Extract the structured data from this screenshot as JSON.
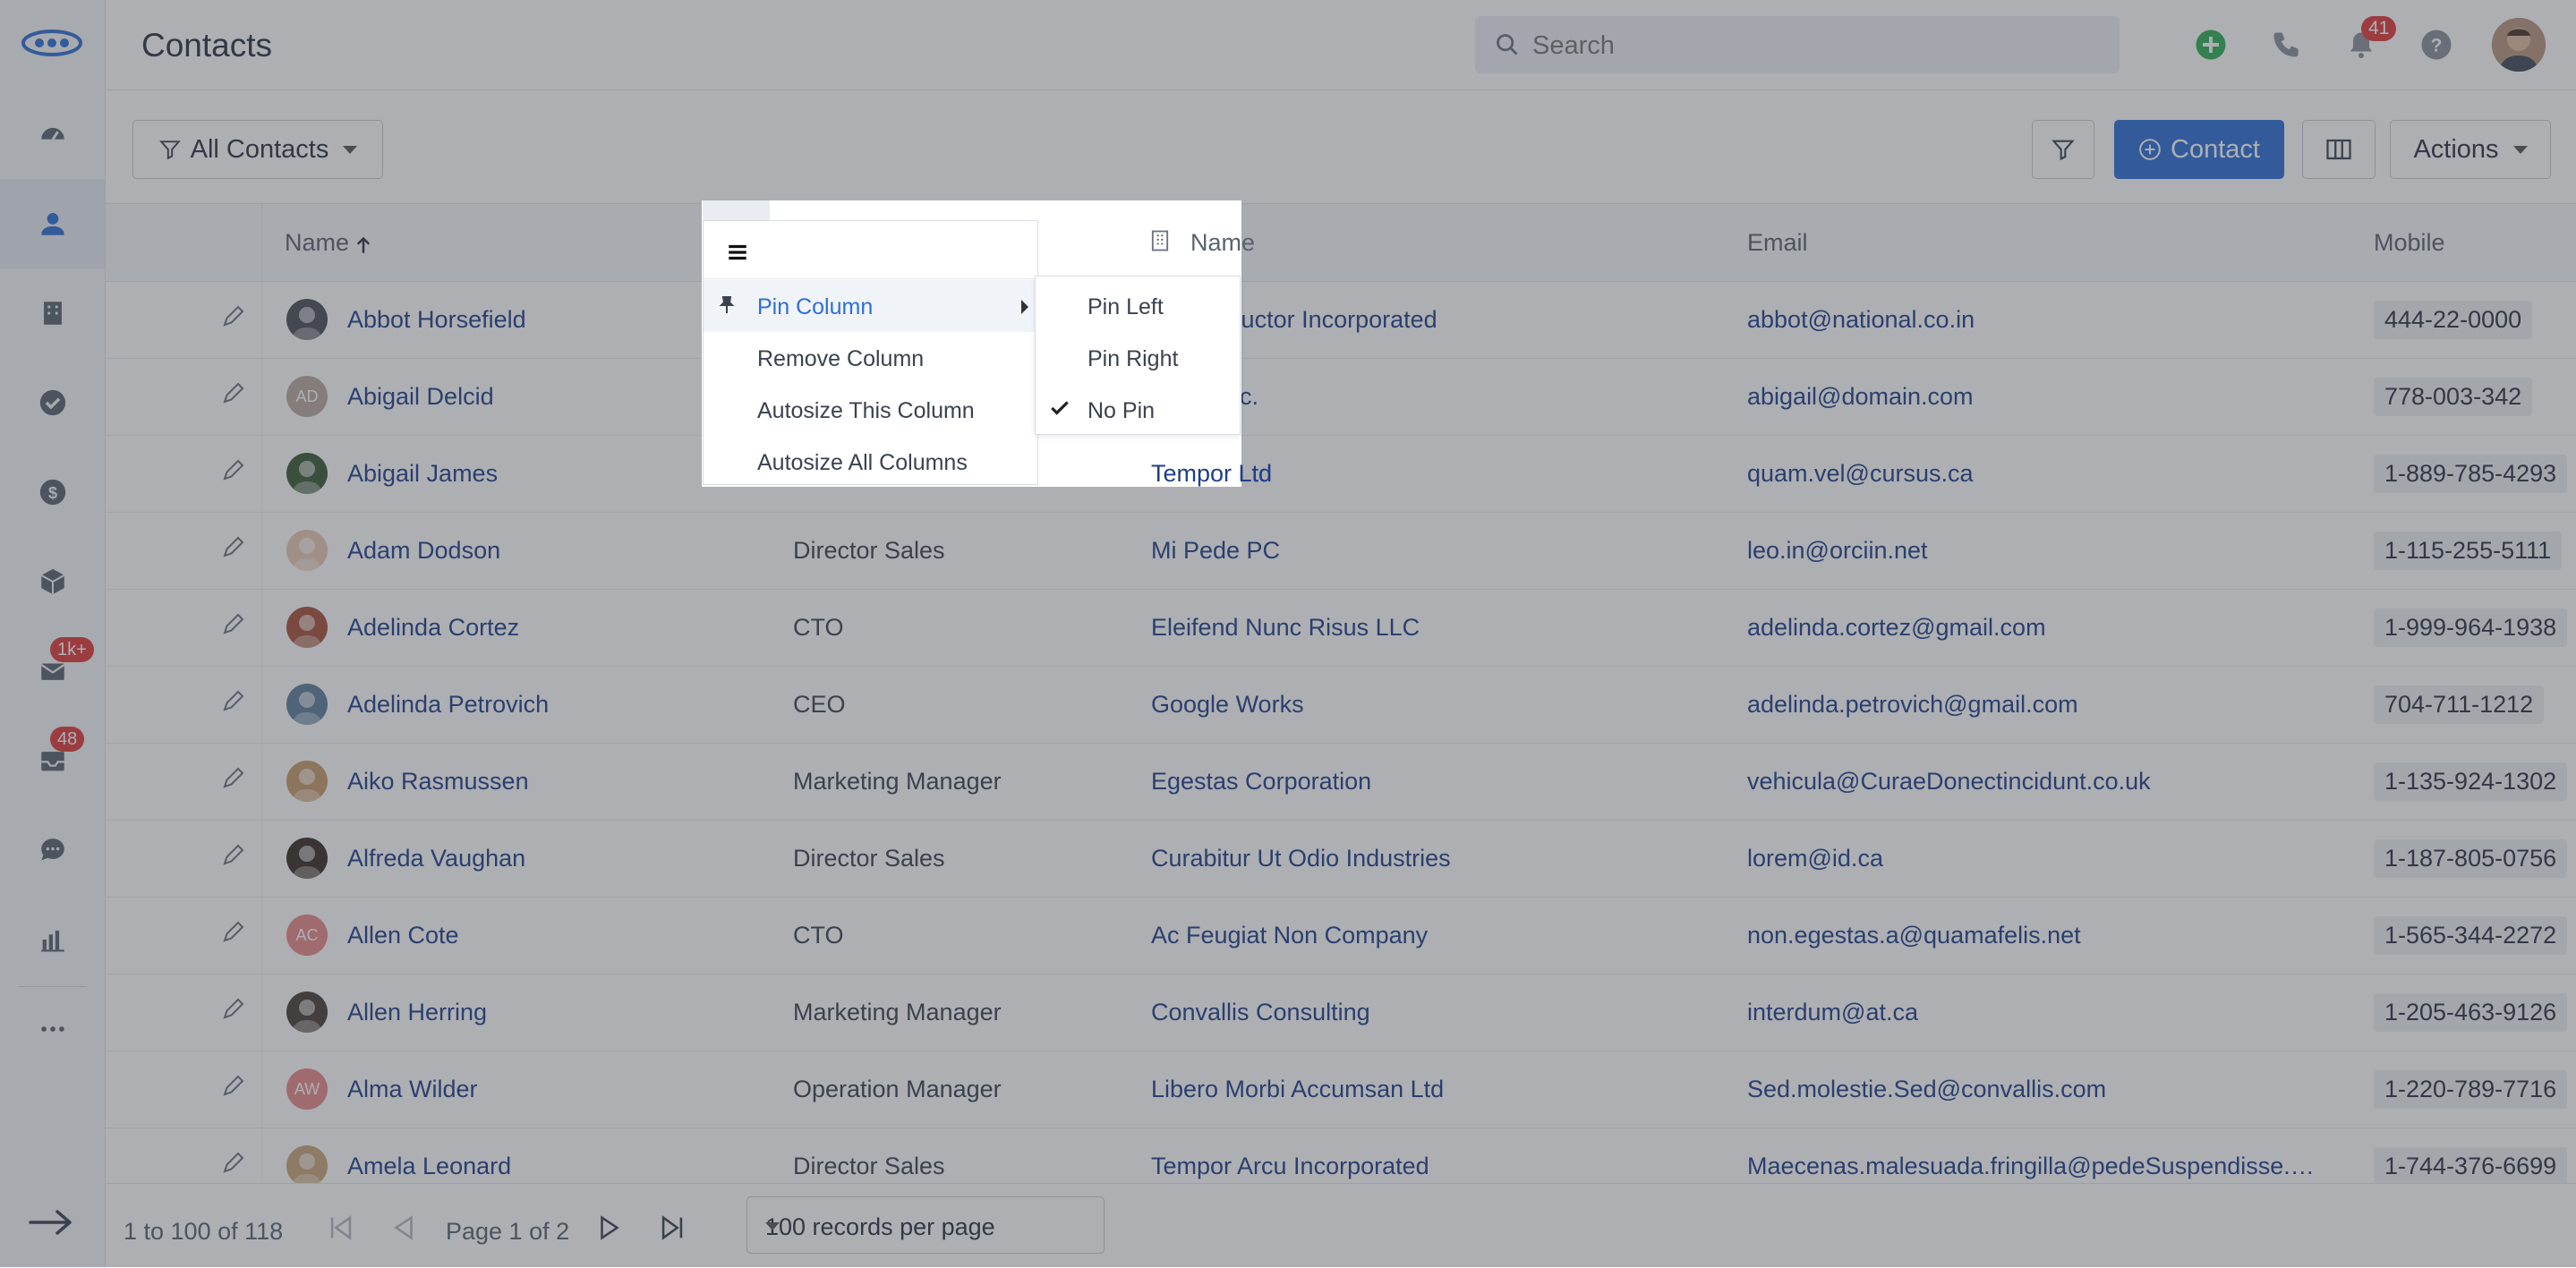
{
  "header": {
    "title": "Contacts",
    "search_placeholder": "Search",
    "notification_count": "41"
  },
  "sidebar": {
    "items": [
      {
        "name": "dashboard",
        "icon": "gauge-icon"
      },
      {
        "name": "contacts",
        "icon": "person-icon",
        "active": true
      },
      {
        "name": "companies",
        "icon": "building-icon"
      },
      {
        "name": "tasks",
        "icon": "check-circle-icon"
      },
      {
        "name": "deals",
        "icon": "dollar-icon"
      },
      {
        "name": "products",
        "icon": "box-icon"
      },
      {
        "name": "email",
        "icon": "mail-icon",
        "badge": "1k+"
      },
      {
        "name": "inbox",
        "icon": "inbox-icon",
        "badge": "48"
      },
      {
        "name": "chat",
        "icon": "chat-icon"
      },
      {
        "name": "reports",
        "icon": "bar-chart-icon"
      },
      {
        "name": "more",
        "icon": "ellipsis-icon"
      }
    ]
  },
  "toolbar": {
    "view_label": "All Contacts",
    "add_label": "Contact",
    "actions_label": "Actions"
  },
  "grid": {
    "columns": [
      "Name",
      "Name",
      "Email",
      "Mobile"
    ],
    "rows": [
      {
        "name": "Abbot Horsefield",
        "title": "",
        "company": "Lorem Auctor Incorporated",
        "email": "abbot@national.co.in",
        "mobile": "444-22-0000",
        "initials": "",
        "avatar_color": "#4a4f57"
      },
      {
        "name": "Abigail Delcid",
        "title": "",
        "company": "Mollis Inc.",
        "email": "abigail@domain.com",
        "mobile": "778-003-342",
        "initials": "AD",
        "avatar_color": "#b9a9a2"
      },
      {
        "name": "Abigail James",
        "title": "",
        "company": "Tempor Ltd",
        "email": "quam.vel@cursus.ca",
        "mobile": "1-889-785-4293",
        "initials": "",
        "avatar_color": "#3b5a3a"
      },
      {
        "name": "Adam Dodson",
        "title": "Director Sales",
        "company": "Mi Pede PC",
        "email": "leo.in@orciin.net",
        "mobile": "1-115-255-5111",
        "initials": "",
        "avatar_color": "#e8c9b5"
      },
      {
        "name": "Adelinda Cortez",
        "title": "CTO",
        "company": "Eleifend Nunc Risus LLC",
        "email": "adelinda.cortez@gmail.com",
        "mobile": "1-999-964-1938",
        "initials": "",
        "avatar_color": "#a7523d"
      },
      {
        "name": "Adelinda Petrovich",
        "title": "CEO",
        "company": "Google Works",
        "email": "adelinda.petrovich@gmail.com",
        "mobile": "704-711-1212",
        "initials": "",
        "avatar_color": "#5d7e9c"
      },
      {
        "name": "Aiko Rasmussen",
        "title": "Marketing Manager",
        "company": "Egestas Corporation",
        "email": "vehicula@CuraeDonectincidunt.co.uk",
        "mobile": "1-135-924-1302",
        "initials": "",
        "avatar_color": "#c89a6c"
      },
      {
        "name": "Alfreda Vaughan",
        "title": "Director Sales",
        "company": "Curabitur Ut Odio Industries",
        "email": "lorem@id.ca",
        "mobile": "1-187-805-0756",
        "initials": "",
        "avatar_color": "#3a2b26"
      },
      {
        "name": "Allen Cote",
        "title": "CTO",
        "company": "Ac Feugiat Non Company",
        "email": "non.egestas.a@quamafelis.net",
        "mobile": "1-565-344-2272",
        "initials": "AC",
        "avatar_color": "#e98a8a"
      },
      {
        "name": "Allen Herring",
        "title": "Marketing Manager",
        "company": "Convallis Consulting",
        "email": "interdum@at.ca",
        "mobile": "1-205-463-9126",
        "initials": "",
        "avatar_color": "#4a3f3a"
      },
      {
        "name": "Alma Wilder",
        "title": "Operation Manager",
        "company": "Libero Morbi Accumsan Ltd",
        "email": "Sed.molestie.Sed@convallis.com",
        "mobile": "1-220-789-7716",
        "initials": "AW",
        "avatar_color": "#e98a8a"
      },
      {
        "name": "Amela Leonard",
        "title": "Director Sales",
        "company": "Tempor Arcu Incorporated",
        "email": "Maecenas.malesuada.fringilla@pedeSuspendisse.c...",
        "mobile": "1-744-376-6699",
        "initials": "",
        "avatar_color": "#caa57a"
      }
    ]
  },
  "footer": {
    "range": "1 to 100 of 118",
    "page": "Page 1 of 2",
    "per_page": "100 records per page"
  },
  "column_menu": {
    "items": [
      "Pin Column",
      "Remove Column",
      "Autosize This Column",
      "Autosize All Columns"
    ],
    "submenu": [
      "Pin Left",
      "Pin Right",
      "No Pin"
    ],
    "selected_submenu": "No Pin"
  },
  "colors": {
    "primary": "#2e6fd8",
    "badge": "#e03c3c",
    "link": "#1f3e8c"
  }
}
